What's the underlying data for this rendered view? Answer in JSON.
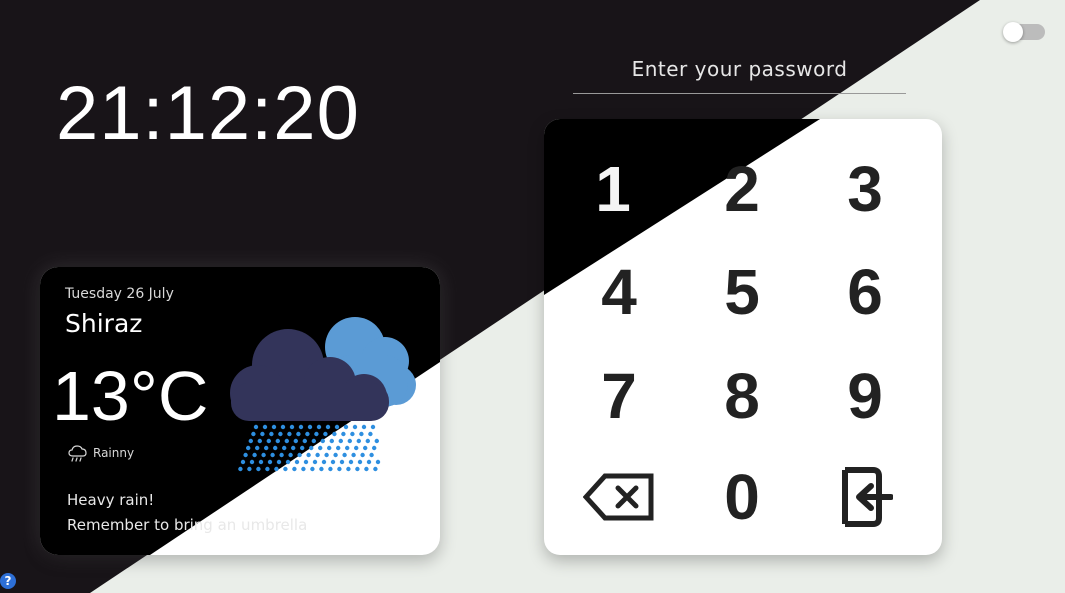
{
  "clock": {
    "time": "21:12:20"
  },
  "password": {
    "placeholder": "Enter your password"
  },
  "keypad": {
    "keys": [
      "1",
      "2",
      "3",
      "4",
      "5",
      "6",
      "7",
      "8",
      "9",
      "0"
    ],
    "backspace_icon": "backspace-icon",
    "enter_icon": "login-icon"
  },
  "weather": {
    "date": "Tuesday 26 July",
    "city": "Shiraz",
    "temperature": "13°C",
    "condition": "Rainny",
    "condition_icon": "rain-cloud-icon",
    "message_line1": "Heavy rain!",
    "message_line2": "Remember to bring an umbrella"
  },
  "help": {
    "symbol": "?"
  },
  "colors": {
    "dark_background": "#181418",
    "light_background": "#eaeee9",
    "cloud_dark": "#33345a",
    "cloud_light": "#5b9bd5",
    "rain_drop": "#2e8fe0",
    "help_blue": "#2d6fd6"
  }
}
